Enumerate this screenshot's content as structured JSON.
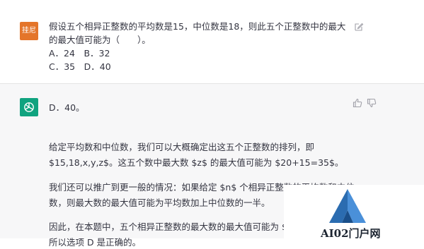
{
  "user": {
    "avatar_label": "挂尼",
    "lines": [
      "假设五个相异正整数的平均数是15，中位数是18，则此五个正整数中的最大",
      "的最大值可能为（　　）。",
      "A．24　B．32",
      "C．35　D．40"
    ]
  },
  "assistant": {
    "answer_line": "D．40。",
    "para1_line1": "给定平均数和中位数，我们可以大概确定出这五个正整数的排列，即",
    "para1_line2": "$15,18,x,y,z$。这五个数中最大数 $z$ 的最大值可能为 $20+15=35$。",
    "para2_line1": "我们还可以推广到更一般的情况：如果给定 $n$ 个相异正整数的平均数和中位",
    "para2_line2": "数，则最大数的最大值可能为平均数加上中位数的一半。",
    "para3_line1": "因此，在本题中，五个相异正整数的最大数的最大值可能为 $1",
    "para3_line2": "所以选项 D 是正确的。"
  },
  "watermark": {
    "text": "AI02门户网"
  },
  "colors": {
    "user_avatar": "#e4752a",
    "bot_avatar": "#10a37f",
    "assistant_bg": "#f7f7f8",
    "logo_blue": "#2b6cb0"
  }
}
